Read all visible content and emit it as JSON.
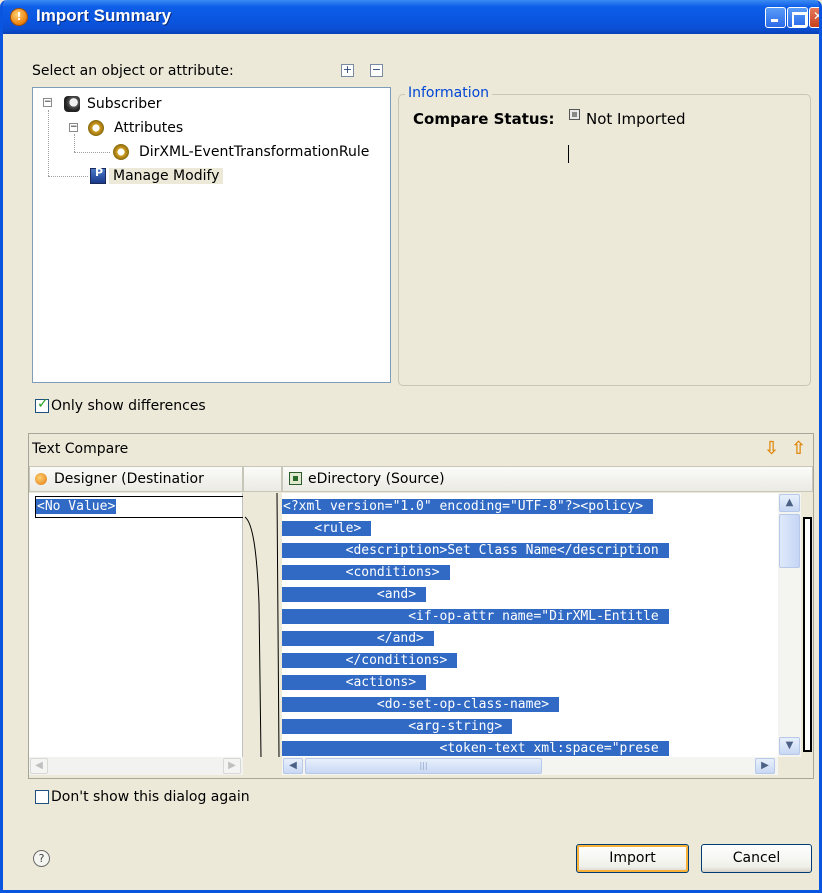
{
  "window": {
    "title": "Import Summary"
  },
  "tree": {
    "label": "Select an object or attribute:",
    "items": [
      {
        "label": "Subscriber",
        "icon": "subscriber-icon"
      },
      {
        "label": "Attributes",
        "icon": "attributes-icon"
      },
      {
        "label": "DirXML-EventTransformationRule",
        "icon": "attribute-icon"
      },
      {
        "label": "Manage Modify",
        "icon": "policy-icon"
      }
    ]
  },
  "information": {
    "legend": "Information",
    "compare_status_label": "Compare Status:",
    "compare_status_value": "Not Imported"
  },
  "options": {
    "only_show_differences": "Only show differences",
    "only_show_differences_checked": true,
    "dont_show_again": "Don't show this dialog again",
    "dont_show_again_checked": false
  },
  "text_compare": {
    "title": "Text Compare",
    "left_header": "Designer (Destinatior",
    "right_header": "eDirectory (Source)",
    "left_value": "<No Value>",
    "right_lines": [
      "<?xml version=\"1.0\" encoding=\"UTF-8\"?><policy>",
      "    <rule>",
      "        <description>Set Class Name</description",
      "        <conditions>",
      "            <and>",
      "                <if-op-attr name=\"DirXML-Entitle",
      "            </and>",
      "        </conditions>",
      "        <actions>",
      "            <do-set-op-class-name>",
      "                <arg-string>",
      "                    <token-text xml:space=\"prese"
    ]
  },
  "buttons": {
    "import": "Import",
    "cancel": "Cancel"
  },
  "colors": {
    "titlebar": "#0a55e0",
    "selection": "#316ac5",
    "accent_link": "#0046d5"
  }
}
